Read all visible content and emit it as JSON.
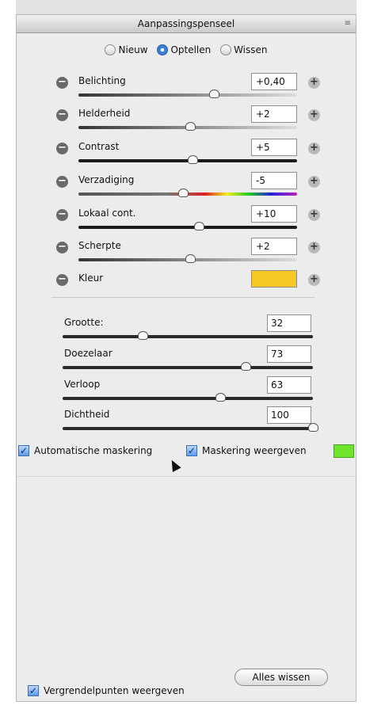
{
  "panel": {
    "title": "Aanpassingspenseel"
  },
  "modes": [
    {
      "label": "Nieuw",
      "selected": false
    },
    {
      "label": "Optellen",
      "selected": true
    },
    {
      "label": "Wissen",
      "selected": false
    }
  ],
  "adjustments": [
    {
      "label": "Belichting",
      "value": "+0,40",
      "slider_fraction": 0.62
    },
    {
      "label": "Helderheid",
      "value": "+2",
      "slider_fraction": 0.51
    },
    {
      "label": "Contrast",
      "value": "+5",
      "slider_fraction": 0.52
    },
    {
      "label": "Verzadiging",
      "value": "-5",
      "slider_fraction": 0.48
    },
    {
      "label": "Lokaal cont.",
      "value": "+10",
      "slider_fraction": 0.55
    },
    {
      "label": "Scherpte",
      "value": "+2",
      "slider_fraction": 0.51
    }
  ],
  "color": {
    "label": "Kleur",
    "swatch_color": "#f7c925"
  },
  "brush": [
    {
      "label": "Grootte:",
      "value": "32",
      "slider_fraction": 0.32
    },
    {
      "label": "Doezelaar",
      "value": "73",
      "slider_fraction": 0.73
    },
    {
      "label": "Verloop",
      "value": "63",
      "slider_fraction": 0.63
    },
    {
      "label": "Dichtheid",
      "value": "100",
      "slider_fraction": 1.0
    }
  ],
  "options": {
    "auto_mask_label": "Automatische maskering",
    "auto_mask_checked": true,
    "show_mask_label": "Maskering weergeven",
    "show_mask_checked": true,
    "mask_color": "#6ee52c"
  },
  "footer": {
    "show_pins_label": "Vergrendelpunten weergeven",
    "show_pins_checked": true,
    "clear_all_label": "Alles wissen"
  }
}
